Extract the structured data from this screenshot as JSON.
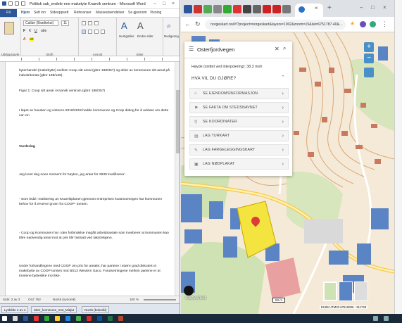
{
  "word": {
    "title": "Politisk sak_endele ene maketyte Knarvik sentrum - Microsoft Word",
    "file_tab": "Fil",
    "tabs": [
      "Hjem",
      "Sett inn",
      "Sideoppsett",
      "Referanser",
      "Masseutsendelser",
      "Se gjennom",
      "Visning"
    ],
    "font_name": "Calibri (Brødtekst)",
    "font_size": "11",
    "styles_label": "Hurtigstiler",
    "change_styles_label": "Endre stiler",
    "editing_label": "Redigering",
    "groups": [
      "Utklippstavle",
      "Skrift",
      "Avsnitt",
      "Stiler"
    ],
    "paragraphs": [
      "byterhandel (makebytte) mellom Coop sitt areal (gbnr 188/357) og deler av kommunen sitt areal på industritomta (gbnr 188/136).",
      "Figur 1: Coop sitt areal i Knarvik sentrum (gbnr 188/357)",
      "I løpet av hausten og vinteren 2018/2019 hadde kommunen og Coop dialog for å avklare om dette var ein",
      "Vurdering",
      "Jeg lovet deg noen moment for høyten, jeg antar for 2630 kvalifiserer:",
      "- Som ledd i realisering av Knarvikplanen gjennom entreprisen kvasmoevegen har kommunen behov for å erverve grunn fra COOP- tomten.",
      "- Coop og Kommunen har i den forbindelse inngått arbeidsavtale som inneberer at kommunen kan tiltre nødvendig areal mot at pris blir fastsatt ved takst/skjønn.",
      "Under forhandlingene med COOP om pris for arealet, har partene i større grad diskutert et makebytte av COOP tomten mot BS13 Western Gaco. Forutsetningene mellom partene er at tomtene bytteslike mot like."
    ],
    "status": {
      "page": "Side: 2 av 3",
      "words": "Ord: 762",
      "language": "Norsk (nynorsk)",
      "zoom": "100 %"
    },
    "doc_tabs": [
      "Lysbilde 4 av 4",
      "Siter_kommune_mot_Midjut",
      "Norsk (bokmål)"
    ]
  },
  "browser": {
    "url": "norgeskart.no/#!?project=norgeskart&layers=1002&zoom=15&lat=6751787.40&...",
    "tab_close": "×",
    "new_tab": "+"
  },
  "panel": {
    "title": "Osterfjordvegen",
    "height": "Høyde (snittet ved interpolering): 38.3 moh",
    "question": "HVA VIL DU GJØRE?",
    "items": [
      {
        "label": "SE EIENDOMSINFORMASJON",
        "icon": "house-icon"
      },
      {
        "label": "SE FAKTA OM STEDSNAVNET",
        "icon": "flag-icon"
      },
      {
        "label": "SE KOORDINATER",
        "icon": "pin-icon"
      },
      {
        "label": "LAG TURKART",
        "icon": "document-icon"
      },
      {
        "label": "LAG FARGELEGGINGSKART",
        "icon": "pencil-icon"
      },
      {
        "label": "LAG NØDPLAKAT",
        "icon": "sign-icon"
      }
    ]
  },
  "map": {
    "logo": "Kartverket",
    "scale": "50 m",
    "coords": "EU89 UTM33 67516086 - 311748"
  }
}
